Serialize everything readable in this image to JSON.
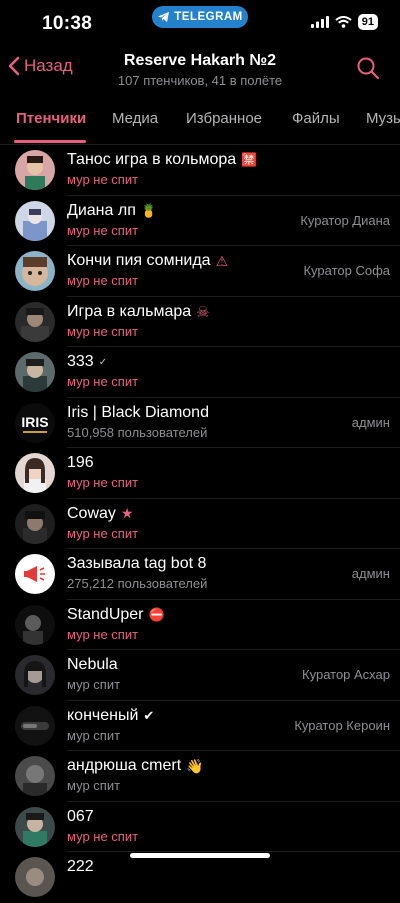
{
  "status_bar": {
    "time": "10:38",
    "badge": "TELEGRAM",
    "battery": "91"
  },
  "header": {
    "back_label": "Назад",
    "title": "Reserve Hakarh №2",
    "subtitle": "107 птенчиков, 41 в полёте"
  },
  "tabs": [
    "Птенчики",
    "Медиа",
    "Избранное",
    "Файлы",
    "Музы"
  ],
  "members": [
    {
      "name": "Танос игра в кольмора",
      "emoji": "🈲",
      "status": "мур не спит",
      "role": ""
    },
    {
      "name": "Диана лп",
      "emoji": "🍍",
      "status": "мур не спит",
      "role": "Куратор Диана"
    },
    {
      "name": "Кончи пия сомнида",
      "emoji": "⚠",
      "status": "мур не спит",
      "role": "Куратор Софа"
    },
    {
      "name": "Игра в кальмара",
      "emoji": "☠",
      "status": "мур не спит",
      "role": ""
    },
    {
      "name": "333",
      "emoji": "✓",
      "status": "мур не спит",
      "role": ""
    },
    {
      "name": "Iris | Black Diamond",
      "emoji": "",
      "status": "510,958 пользователей",
      "role": "админ"
    },
    {
      "name": "196",
      "emoji": "",
      "status": "мур не спит",
      "role": ""
    },
    {
      "name": "Coway",
      "emoji": "★",
      "status": "мур не спит",
      "role": ""
    },
    {
      "name": "Зазывала tag bot 8",
      "emoji": "",
      "status": "275,212 пользователей",
      "role": "админ"
    },
    {
      "name": "StandUper",
      "emoji": "⛔",
      "status": "мур не спит",
      "role": ""
    },
    {
      "name": "Nebula",
      "emoji": "",
      "status": "мур спит",
      "role": "Куратор Асхар"
    },
    {
      "name": "конченый",
      "emoji": "✔",
      "status": "мур спит",
      "role": "Куратор Кероин"
    },
    {
      "name": "андрюша cmert",
      "emoji": "👋",
      "status": "мур спит",
      "role": ""
    },
    {
      "name": "067",
      "emoji": "",
      "status": "мур не спит",
      "role": ""
    },
    {
      "name": "222",
      "emoji": "",
      "status": "",
      "role": ""
    }
  ],
  "colors": {
    "accent": "#e8607e",
    "telegram": "#2481cc",
    "secondary": "#8e8e93"
  }
}
